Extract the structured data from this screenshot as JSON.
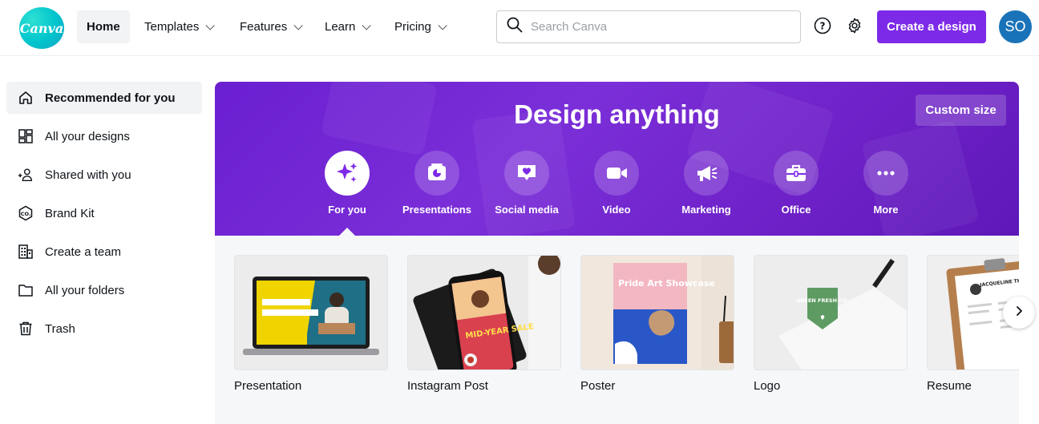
{
  "brand": {
    "logo_text": "Canva",
    "accent": "#7d2ae8",
    "logo_color": "#00c4cc"
  },
  "nav": [
    {
      "label": "Home",
      "active": true,
      "dropdown": false
    },
    {
      "label": "Templates",
      "dropdown": true
    },
    {
      "label": "Features",
      "dropdown": true
    },
    {
      "label": "Learn",
      "dropdown": true
    },
    {
      "label": "Pricing",
      "dropdown": true
    }
  ],
  "search": {
    "placeholder": "Search Canva",
    "value": ""
  },
  "header": {
    "help_icon": "help-icon",
    "settings_icon": "gear-icon",
    "create_label": "Create a design",
    "avatar_initials": "SO"
  },
  "sidebar": {
    "items": [
      {
        "label": "Recommended for you",
        "icon": "home-icon",
        "active": true
      },
      {
        "label": "All your designs",
        "icon": "grid-icon"
      },
      {
        "label": "Shared with you",
        "icon": "people-icon"
      },
      {
        "label": "Brand Kit",
        "icon": "brand-kit-icon"
      },
      {
        "label": "Create a team",
        "icon": "building-icon"
      },
      {
        "label": "All your folders",
        "icon": "folder-icon"
      },
      {
        "label": "Trash",
        "icon": "trash-icon"
      }
    ]
  },
  "hero": {
    "title": "Design anything",
    "custom_size_label": "Custom size",
    "categories": [
      {
        "label": "For you",
        "icon": "sparkle-icon",
        "active": true
      },
      {
        "label": "Presentations",
        "icon": "presentation-icon"
      },
      {
        "label": "Social media",
        "icon": "heart-chat-icon"
      },
      {
        "label": "Video",
        "icon": "video-camera-icon"
      },
      {
        "label": "Marketing",
        "icon": "megaphone-icon"
      },
      {
        "label": "Office",
        "icon": "briefcase-icon"
      },
      {
        "label": "More",
        "icon": "more-dots-icon"
      }
    ]
  },
  "designs": [
    {
      "label": "Presentation",
      "thumb_text": ""
    },
    {
      "label": "Instagram Post",
      "thumb_text": "MID-YEAR SALE"
    },
    {
      "label": "Poster",
      "thumb_text": "Pride Art Showcase"
    },
    {
      "label": "Logo",
      "thumb_text": "GREEN FRESH CO."
    },
    {
      "label": "Resume",
      "thumb_text": "JACQUELINE THOMPSON"
    }
  ]
}
